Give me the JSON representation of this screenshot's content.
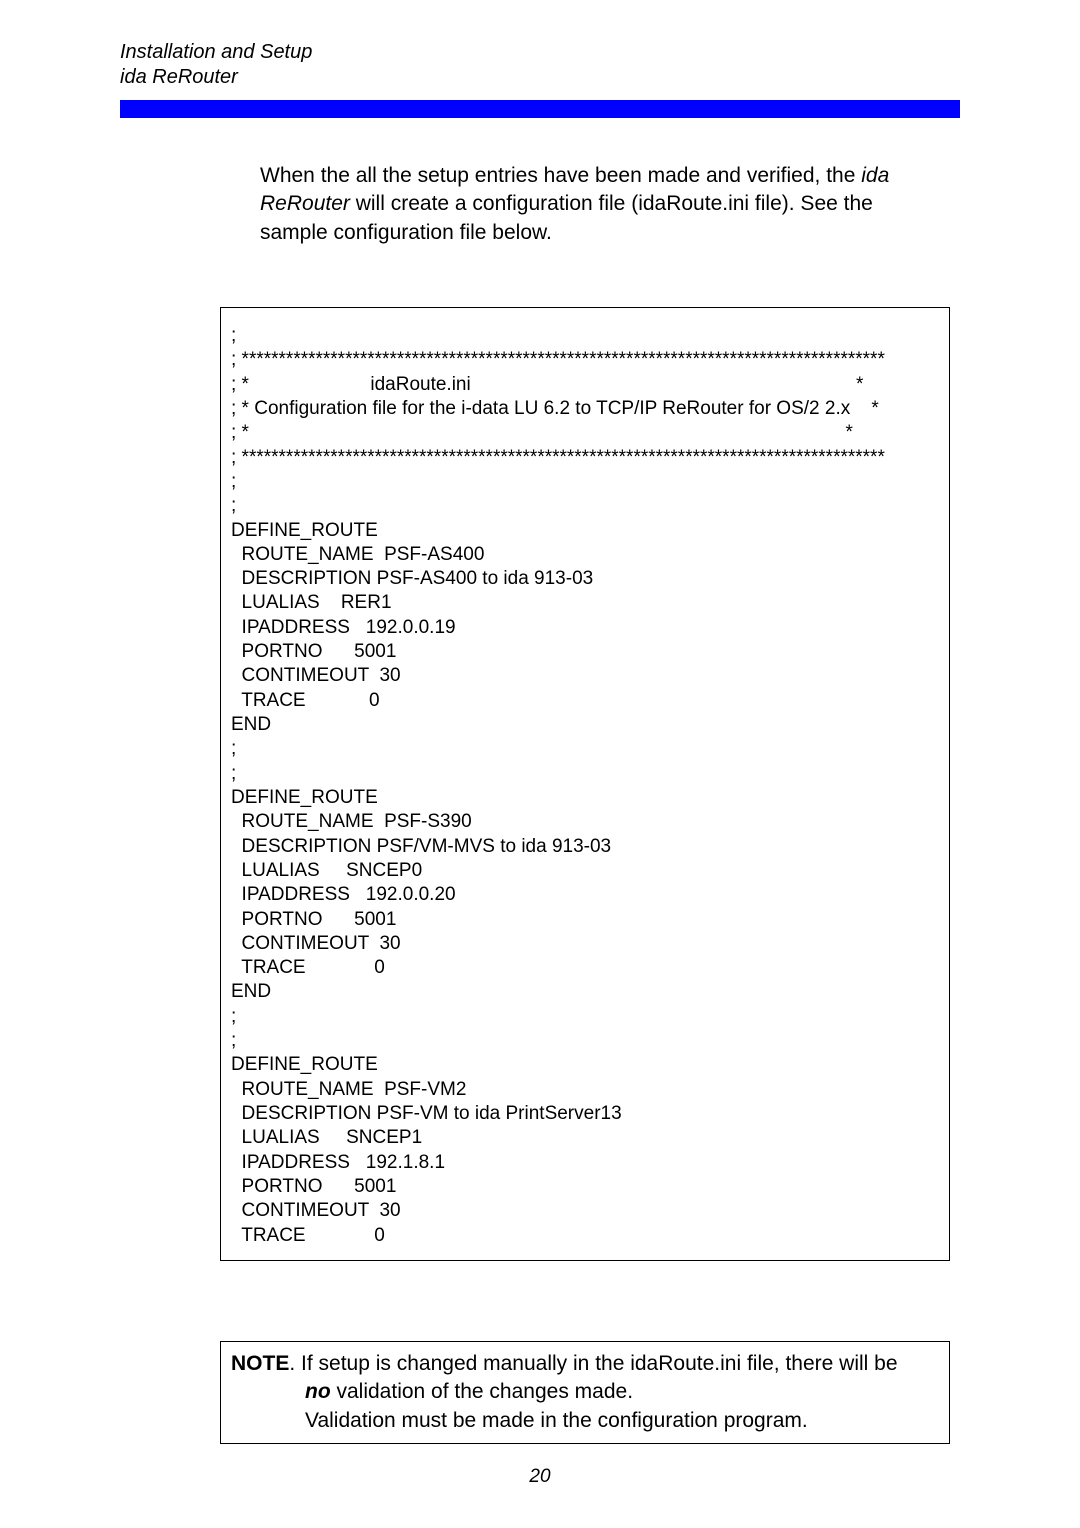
{
  "header": {
    "line1": "Installation and Setup",
    "line2": "ida ReRouter"
  },
  "intro": {
    "pre": "When the all the setup entries have been made and verified, the ",
    "ida": "ida ReRouter",
    "post": " will create a configuration file (idaRoute.ini   file). See the sample configuration file below."
  },
  "code": ";\n; ***************************************************************************************\n; *                       idaRoute.ini                                                                         *\n; * Configuration file for the i-data LU 6.2 to TCP/IP ReRouter for OS/2 2.x    *\n; *                                                                                                                 *\n; ***************************************************************************************\n;\n;\nDEFINE_ROUTE\n  ROUTE_NAME  PSF-AS400\n  DESCRIPTION PSF-AS400 to ida 913-03\n  LUALIAS    RER1\n  IPADDRESS   192.0.0.19\n  PORTNO      5001\n  CONTIMEOUT  30\n  TRACE            0\nEND\n;\n;\nDEFINE_ROUTE\n  ROUTE_NAME  PSF-S390\n  DESCRIPTION PSF/VM-MVS to ida 913-03\n  LUALIAS     SNCEP0\n  IPADDRESS   192.0.0.20\n  PORTNO      5001\n  CONTIMEOUT  30\n  TRACE             0\nEND\n;\n;\nDEFINE_ROUTE\n  ROUTE_NAME  PSF-VM2\n  DESCRIPTION PSF-VM to ida PrintServer13\n  LUALIAS     SNCEP1\n  IPADDRESS   192.1.8.1\n  PORTNO      5001\n  CONTIMEOUT  30\n  TRACE             0",
  "note": {
    "label": "NOTE",
    "sep": ".  ",
    "line1_a": "If setup is changed manually in the idaRoute.ini file, there will be ",
    "line1_b_no": "no",
    "line1_c": " validation of the changes made.",
    "line2": "Validation must be made in the configuration program."
  },
  "page_number": "20"
}
